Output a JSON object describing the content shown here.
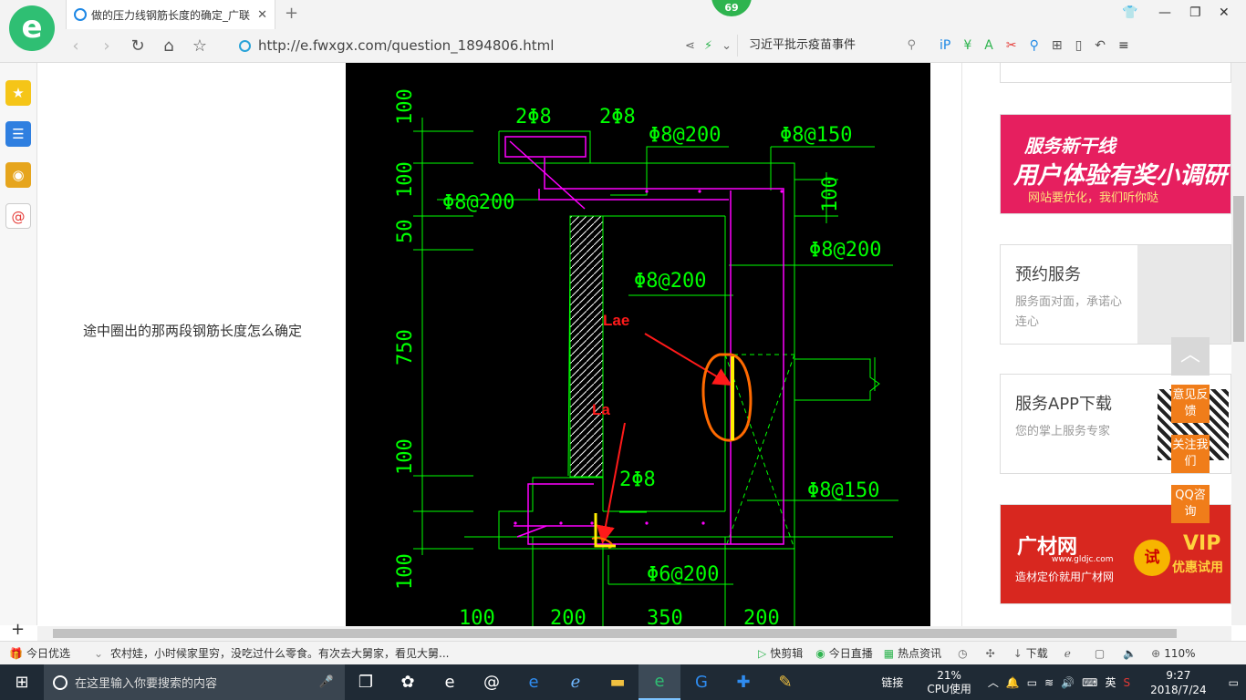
{
  "browser": {
    "tab_title": "做的压力线钢筋长度的确定_广联",
    "tab_close": "✕",
    "new_tab": "+",
    "badge_count": "69",
    "url": "http://e.fwxgx.com/question_1894806.html",
    "hot_search": "习近平批示疫苗事件"
  },
  "page": {
    "question_text": "途中圈出的那两段钢筋长度怎么确定"
  },
  "cad": {
    "dims_left": [
      "100",
      "100",
      "50",
      "750",
      "100",
      "100"
    ],
    "dims_bottom": [
      "100",
      "200",
      "350",
      "200"
    ],
    "labels": {
      "stirrup_top1": "2Φ8",
      "stirrup_top2": "2Φ8",
      "phi8_200_a": "Φ8@200",
      "phi8_150_a": "Φ8@150",
      "phi8_200_left": "Φ8@200",
      "dim_100_right": "100",
      "phi8_200_b": "Φ8@200",
      "phi8_200_c": "Φ8@200",
      "lae": "Lae",
      "la": "La",
      "bottom_2phi8": "2Φ8",
      "phi8_150_b": "Φ8@150",
      "phi6_200": "Φ6@200"
    }
  },
  "sidebar_ads": {
    "banner1": {
      "line1": "服务新干线",
      "line2": "用户体验有奖小调研",
      "line3": "网站要优化，我们听你哒"
    },
    "service1": {
      "title": "预约服务",
      "desc": "服务面对面，承诺心连心"
    },
    "service2": {
      "title": "服务APP下载",
      "desc": "您的掌上服务专家"
    },
    "banner2": {
      "name": "广材网",
      "url": "www.gldjc.com",
      "slogan": "造材定价就用广材网",
      "try": "试",
      "vip": "VIP",
      "trial": "优惠试用"
    }
  },
  "float_buttons": {
    "feedback": "意见反馈",
    "follow": "关注我们",
    "qq": "QQ咨询",
    "to_top": "︿"
  },
  "statusbar": {
    "left_label": "今日优选",
    "news": "农村娃，小时候家里穷，没吃过什么零食。有次去大舅家，看见大舅...",
    "kuaijianji": "快剪辑",
    "today_live": "今日直播",
    "hot_news": "热点资讯",
    "download": "下载",
    "zoom": "110%"
  },
  "taskbar": {
    "search_placeholder": "在这里输入你要搜索的内容",
    "link_label": "链接",
    "cpu_percent": "21%",
    "cpu_label": "CPU使用",
    "ime": "英",
    "time": "9:27",
    "date": "2018/7/24"
  },
  "colors": {
    "cad_bg": "#000000",
    "cad_green": "#00ff00",
    "cad_magenta": "#ff00ff",
    "highlight_yellow": "#ffee00",
    "annotation_red": "#ff1a1a",
    "circle_orange": "#ff6a00",
    "float_orange": "#f07d1a"
  }
}
